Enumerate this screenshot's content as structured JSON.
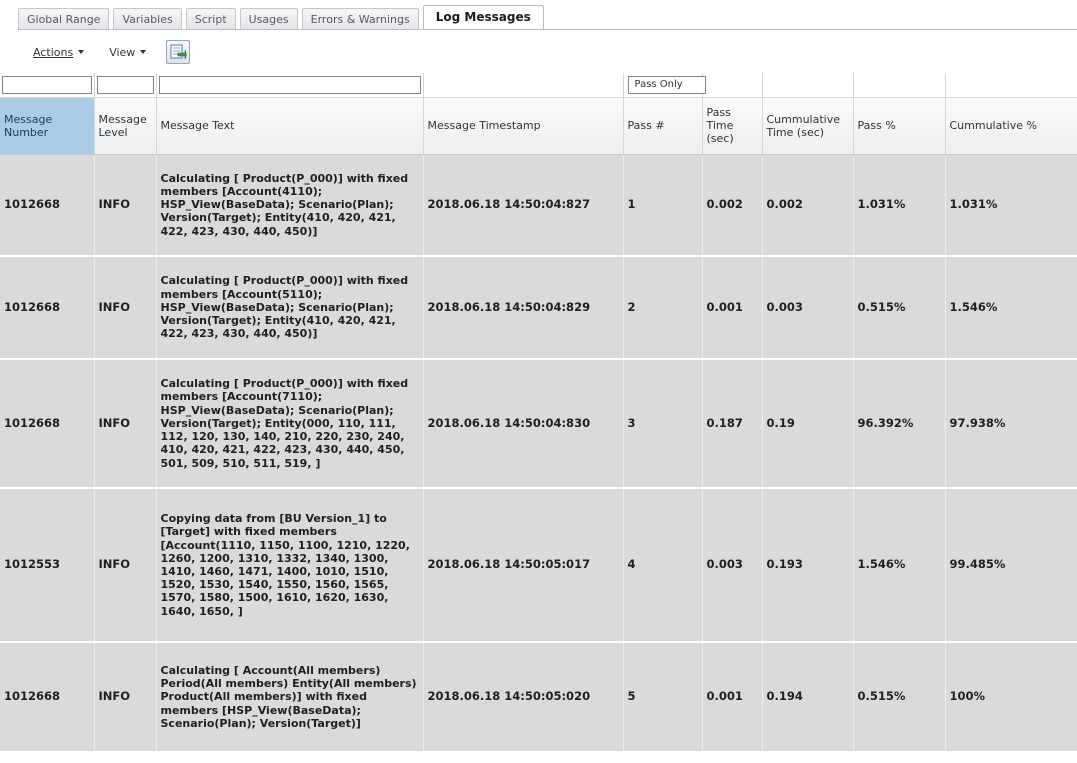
{
  "tabs": [
    {
      "label": "Global Range",
      "active": false
    },
    {
      "label": "Variables",
      "active": false
    },
    {
      "label": "Script",
      "active": false
    },
    {
      "label": "Usages",
      "active": false
    },
    {
      "label": "Errors & Warnings",
      "active": false
    },
    {
      "label": "Log Messages",
      "active": true
    }
  ],
  "toolbar": {
    "actions_label": "Actions",
    "view_label": "View",
    "export_icon": "export-to-excel-icon"
  },
  "filters": {
    "pass_only_label": "Pass Only"
  },
  "columns": [
    "Message Number",
    "Message Level",
    "Message Text",
    "Message Timestamp",
    "Pass #",
    "Pass Time (sec)",
    "Cummulative Time (sec)",
    "Pass %",
    "Cummulative %"
  ],
  "rows": [
    {
      "number": "1012668",
      "level": "INFO",
      "text": "Calculating [ Product(P_000)] with fixed members [Account(4110); HSP_View(BaseData); Scenario(Plan); Version(Target); Entity(410, 420, 421, 422, 423, 430, 440, 450)]",
      "timestamp": "2018.06.18 14:50:04:827",
      "pass": "1",
      "pass_time": "0.002",
      "cum_time": "0.002",
      "pass_pct": "1.031%",
      "cum_pct": "1.031%"
    },
    {
      "number": "1012668",
      "level": "INFO",
      "text": "Calculating [ Product(P_000)] with fixed members [Account(5110); HSP_View(BaseData); Scenario(Plan); Version(Target); Entity(410, 420, 421, 422, 423, 430, 440, 450)]",
      "timestamp": "2018.06.18 14:50:04:829",
      "pass": "2",
      "pass_time": "0.001",
      "cum_time": "0.003",
      "pass_pct": "0.515%",
      "cum_pct": "1.546%"
    },
    {
      "number": "1012668",
      "level": "INFO",
      "text": "Calculating [ Product(P_000)] with fixed members [Account(7110); HSP_View(BaseData); Scenario(Plan); Version(Target); Entity(000, 110, 111, 112, 120, 130, 140, 210, 220, 230, 240, 410, 420, 421, 422, 423, 430, 440, 450, 501, 509, 510, 511, 519, ]",
      "timestamp": "2018.06.18 14:50:04:830",
      "pass": "3",
      "pass_time": "0.187",
      "cum_time": "0.19",
      "pass_pct": "96.392%",
      "cum_pct": "97.938%"
    },
    {
      "number": "1012553",
      "level": "INFO",
      "text": "Copying data from [BU Version_1] to [Target] with fixed members [Account(1110, 1150, 1100, 1210, 1220, 1260, 1200, 1310, 1332, 1340, 1300, 1410, 1460, 1471, 1400, 1010, 1510, 1520, 1530, 1540, 1550, 1560, 1565, 1570, 1580, 1500, 1610, 1620, 1630, 1640, 1650, ]",
      "timestamp": "2018.06.18 14:50:05:017",
      "pass": "4",
      "pass_time": "0.003",
      "cum_time": "0.193",
      "pass_pct": "1.546%",
      "cum_pct": "99.485%"
    },
    {
      "number": "1012668",
      "level": "INFO",
      "text": "Calculating [ Account(All members) Period(All members) Entity(All members) Product(All members)] with fixed members [HSP_View(BaseData); Scenario(Plan); Version(Target)]",
      "timestamp": "2018.06.18 14:50:05:020",
      "pass": "5",
      "pass_time": "0.001",
      "cum_time": "0.194",
      "pass_pct": "0.515%",
      "cum_pct": "100%"
    }
  ]
}
